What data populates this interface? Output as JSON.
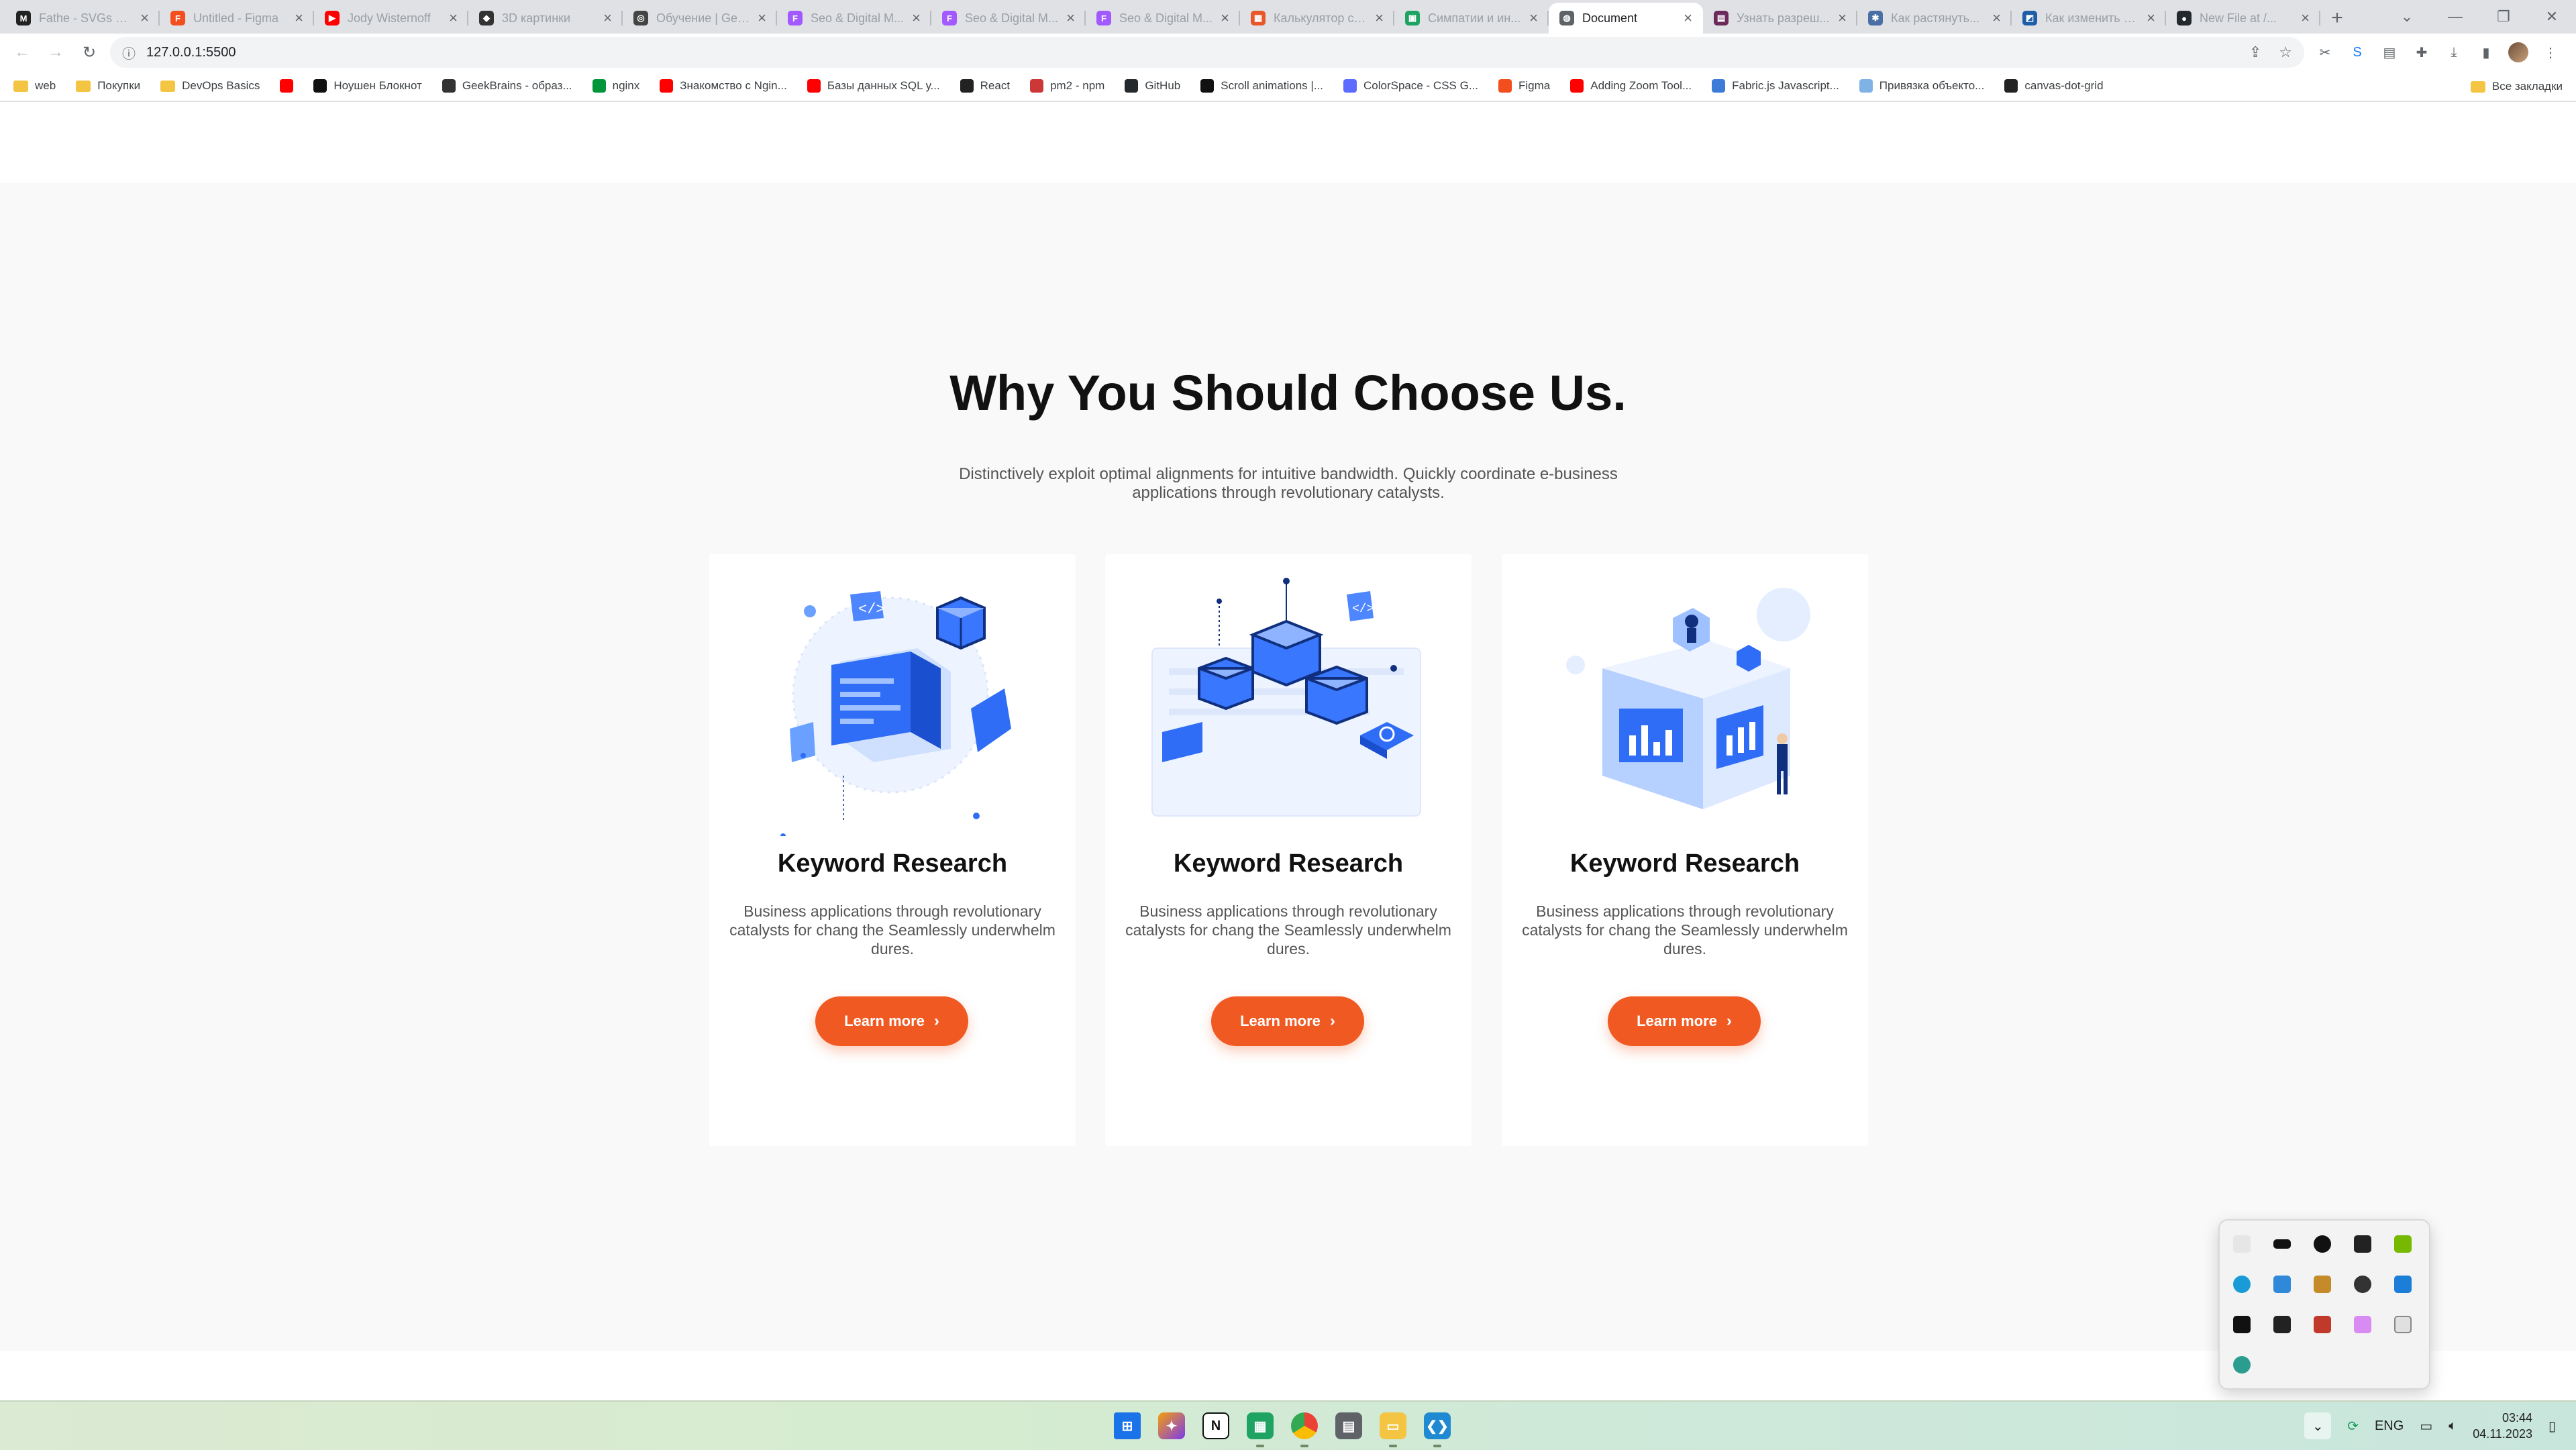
{
  "browser": {
    "tabs": [
      {
        "title": "Fathe - SVGs Sy...",
        "favicon": "M",
        "color": "#222222",
        "active": false
      },
      {
        "title": "Untitled - Figma",
        "favicon": "F",
        "color": "#f24e1e",
        "active": false
      },
      {
        "title": "Jody Wisternoff",
        "favicon": "▶",
        "color": "#ff0000",
        "active": false
      },
      {
        "title": "3D картинки",
        "favicon": "◆",
        "color": "#333333",
        "active": false
      },
      {
        "title": "Обучение | GeekBrains",
        "favicon": "◎",
        "color": "#444444",
        "active": false
      },
      {
        "title": "Seo & Digital M...",
        "favicon": "F",
        "color": "#a259ff",
        "active": false
      },
      {
        "title": "Seo & Digital M...",
        "favicon": "F",
        "color": "#a259ff",
        "active": false
      },
      {
        "title": "Seo & Digital M...",
        "favicon": "F",
        "color": "#a259ff",
        "active": false
      },
      {
        "title": "Калькулятор сс...",
        "favicon": "▦",
        "color": "#e8572a",
        "active": false
      },
      {
        "title": "Симпатии и ин...",
        "favicon": "▣",
        "color": "#1ea362",
        "active": false
      },
      {
        "title": "Document",
        "favicon": "◍",
        "color": "#5f6368",
        "active": true
      },
      {
        "title": "Узнать разреш...",
        "favicon": "▤",
        "color": "#6b2a5c",
        "active": false
      },
      {
        "title": "Как растянуть...",
        "favicon": "✱",
        "color": "#4a6fa5",
        "active": false
      },
      {
        "title": "Как изменить р...",
        "favicon": "◩",
        "color": "#1f5fa8",
        "active": false
      },
      {
        "title": "New File at /...",
        "favicon": "●",
        "color": "#24292e",
        "active": false
      }
    ],
    "url": "127.0.0.1:5500",
    "bookmarks": [
      {
        "label": "web",
        "type": "folder"
      },
      {
        "label": "Покупки",
        "type": "folder"
      },
      {
        "label": "DevOps Basics",
        "type": "folder"
      },
      {
        "label": "",
        "type": "youtube"
      },
      {
        "label": "Ноушен Блокнот",
        "type": "notion"
      },
      {
        "label": "GeekBrains - образ...",
        "type": "geek"
      },
      {
        "label": "nginx",
        "type": "nginx"
      },
      {
        "label": "Знакомство с Ngin...",
        "type": "youtube"
      },
      {
        "label": "Базы данных SQL у...",
        "type": "youtube"
      },
      {
        "label": "React",
        "type": "react"
      },
      {
        "label": "pm2 - npm",
        "type": "npm"
      },
      {
        "label": "GitHub",
        "type": "github"
      },
      {
        "label": "Scroll animations |...",
        "type": "framer"
      },
      {
        "label": "ColorSpace - CSS G...",
        "type": "colorspace"
      },
      {
        "label": "Figma",
        "type": "figma"
      },
      {
        "label": "Adding Zoom Tool...",
        "type": "youtube"
      },
      {
        "label": "Fabric.js Javascript...",
        "type": "fabric"
      },
      {
        "label": "Привязка объекто...",
        "type": "cloud"
      },
      {
        "label": "canvas-dot-grid",
        "type": "codepen"
      }
    ],
    "all_bookmarks": "Все закладки"
  },
  "section": {
    "heading": "Why You Should Choose Us.",
    "subtitle": "Distinctively exploit optimal alignments for intuitive bandwidth. Quickly coordinate e-business applications through revolutionary catalysts."
  },
  "cards": [
    {
      "title": "Keyword Research",
      "text": "Business applications through revolutionary catalysts for chang the Seamlessly underwhelm dures.",
      "button": "Learn more",
      "illustration": "code-window-illustration"
    },
    {
      "title": "Keyword Research",
      "text": "Business applications through revolutionary catalysts for chang the Seamlessly underwhelm dures.",
      "button": "Learn more",
      "illustration": "network-cubes-illustration"
    },
    {
      "title": "Keyword Research",
      "text": "Business applications through revolutionary catalysts for chang the Seamlessly underwhelm dures.",
      "button": "Learn more",
      "illustration": "analytics-building-illustration"
    }
  ],
  "colors": {
    "accent": "#f05a22",
    "section_bg": "#f9f9f9",
    "illustration_blue": "#2f6df6"
  },
  "taskbar": {
    "language": "ENG",
    "time": "03:44",
    "date": "04.11.2023"
  }
}
